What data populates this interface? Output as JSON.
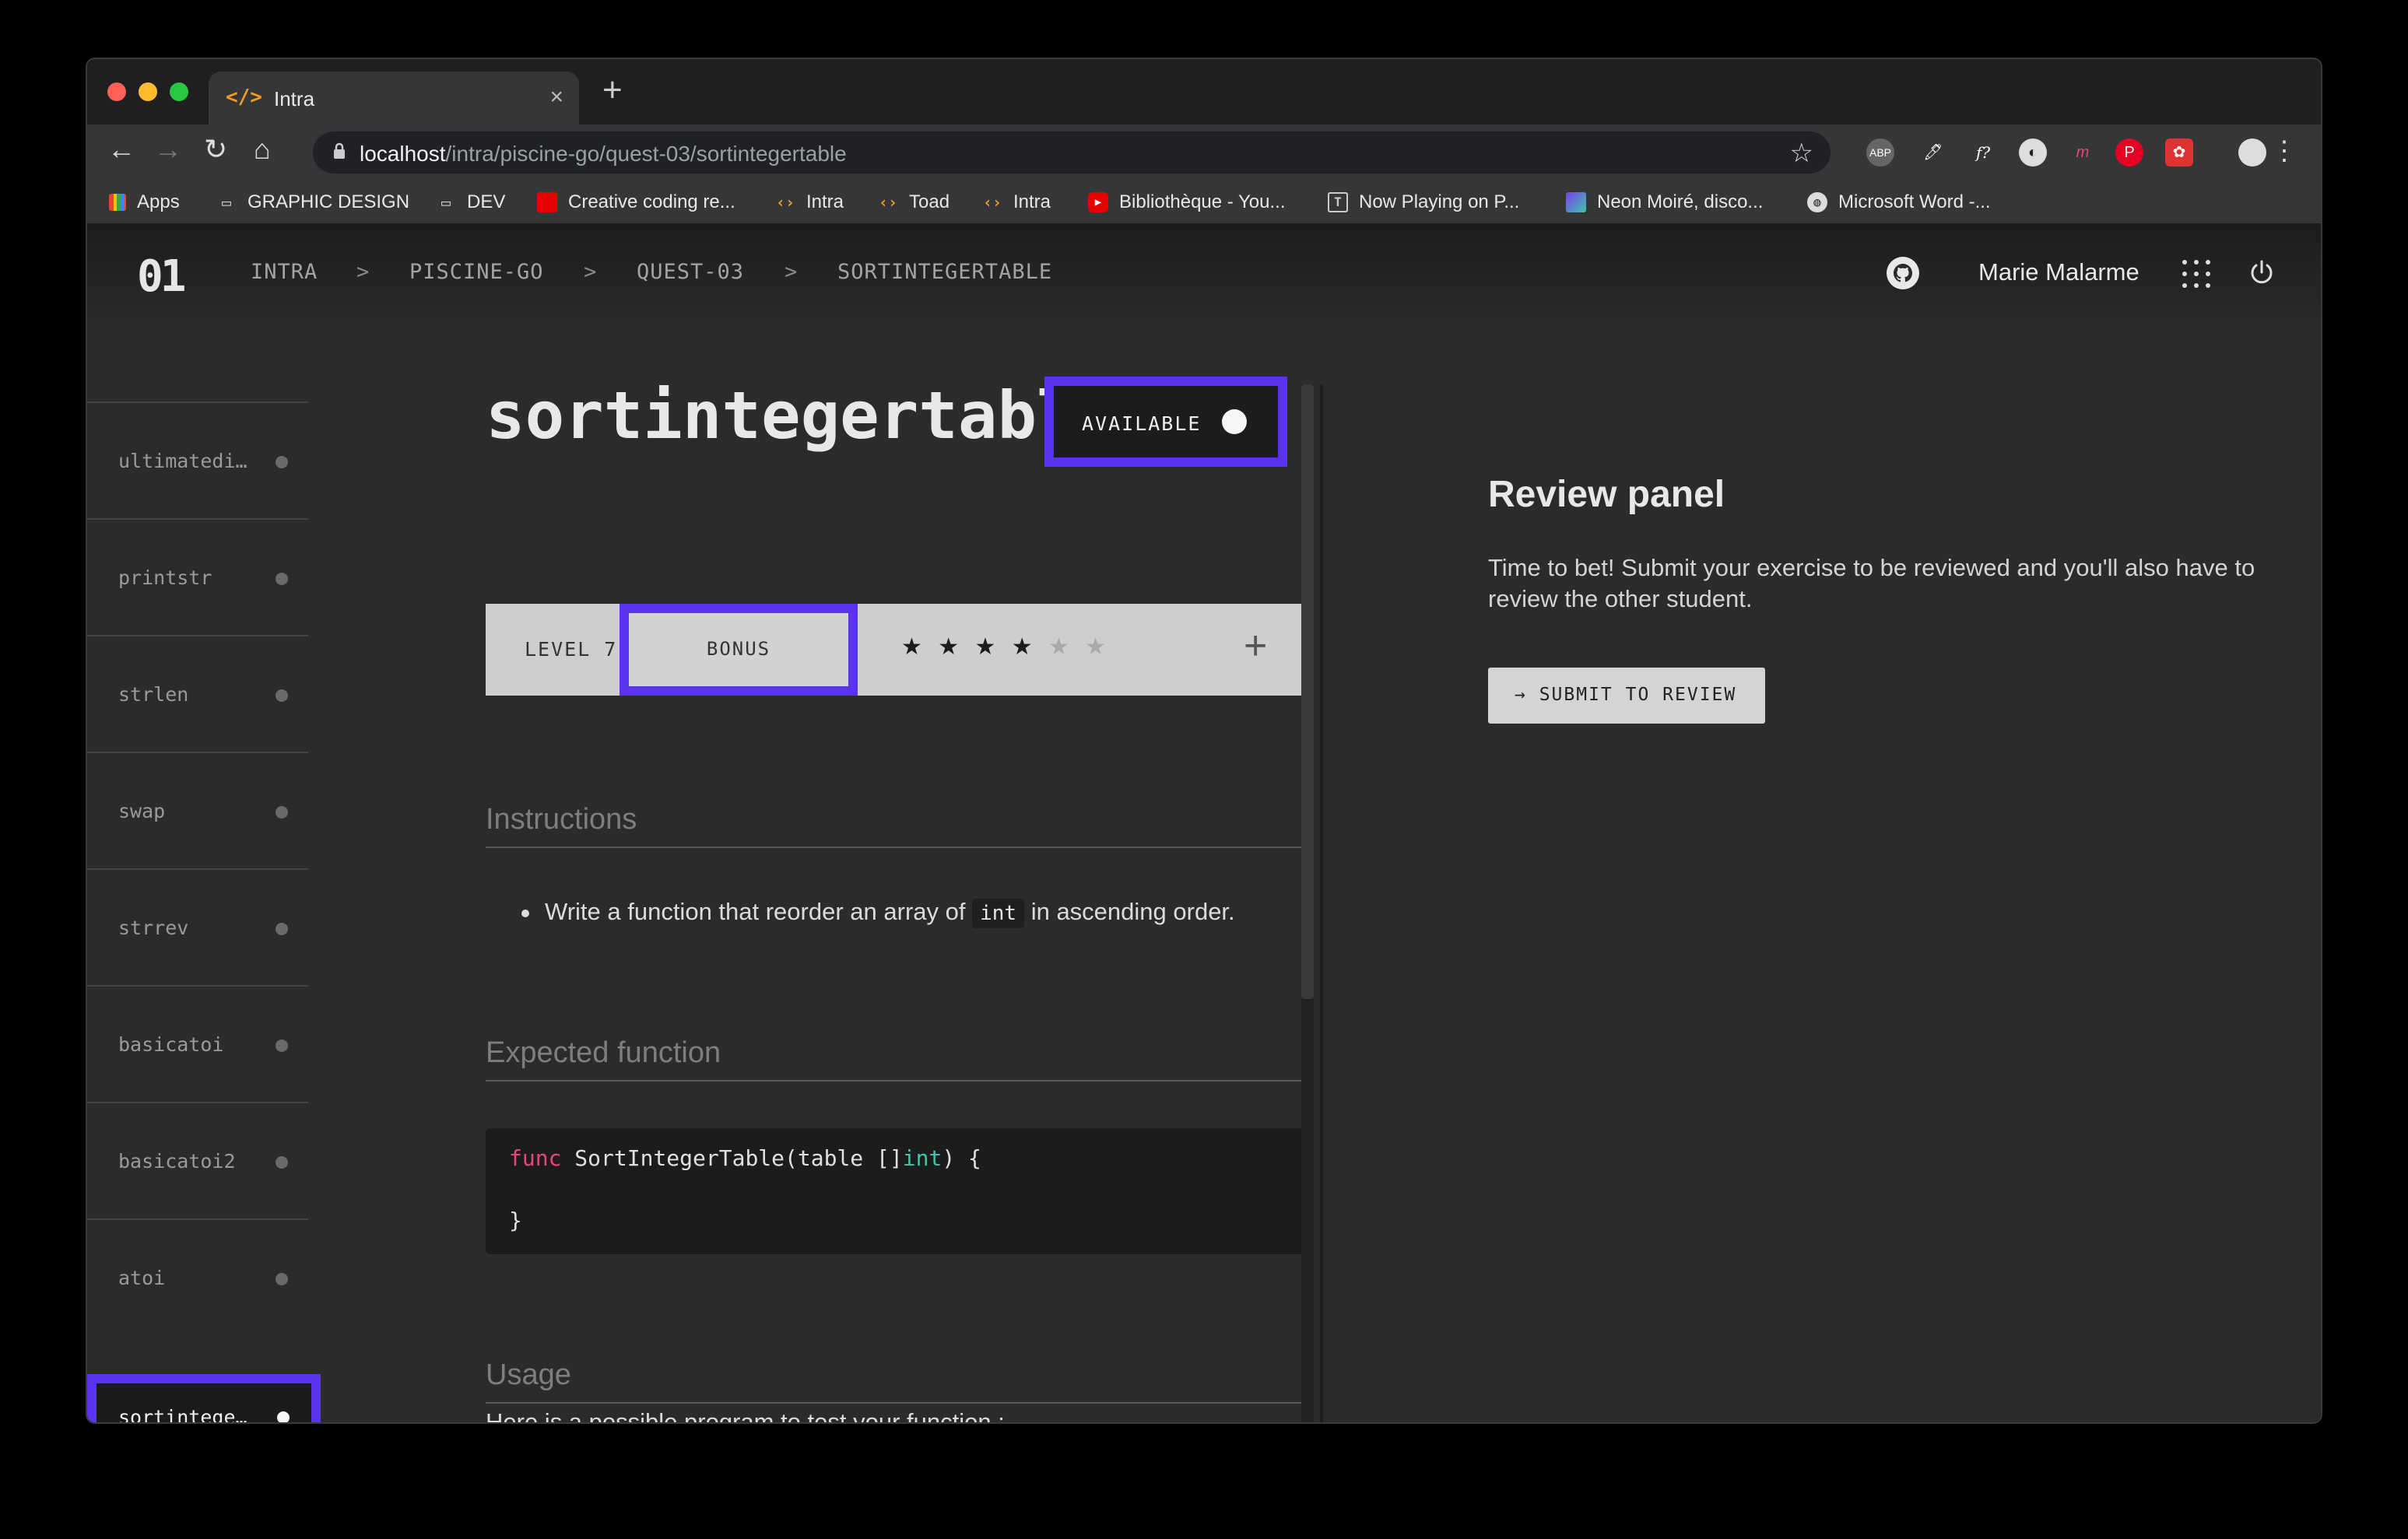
{
  "browser": {
    "tab_title": "Intra",
    "tab_icon": "</>",
    "new_tab": "+",
    "url_host": "localhost",
    "url_path": "/intra/piscine-go/quest-03/sortintegertable",
    "bookmarks": [
      {
        "label": "Apps",
        "icon": "apps-grid-icon"
      },
      {
        "label": "GRAPHIC DESIGN",
        "icon": "folder-icon"
      },
      {
        "label": "DEV",
        "icon": "folder-icon"
      },
      {
        "label": "Creative coding re...",
        "icon": "red-square-icon"
      },
      {
        "label": "Intra",
        "icon": "code-icon"
      },
      {
        "label": "Toad",
        "icon": "code-icon"
      },
      {
        "label": "Intra",
        "icon": "code-icon"
      },
      {
        "label": "Bibliothèque - You...",
        "icon": "youtube-icon"
      },
      {
        "label": "Now Playing on P...",
        "icon": "t-icon"
      },
      {
        "label": "Neon Moiré, disco...",
        "icon": "neon-icon"
      },
      {
        "label": "Microsoft Word -...",
        "icon": "globe-icon"
      }
    ]
  },
  "app": {
    "logo": "01",
    "breadcrumb": [
      "INTRA",
      ">",
      "PISCINE-GO",
      ">",
      "QUEST-03",
      ">",
      "SORTINTEGERTABLE"
    ],
    "user_name": "Marie Malarme"
  },
  "sidebar": {
    "items": [
      {
        "label": "ultimatediv…"
      },
      {
        "label": "printstr"
      },
      {
        "label": "strlen"
      },
      {
        "label": "swap"
      },
      {
        "label": "strrev"
      },
      {
        "label": "basicatoi"
      },
      {
        "label": "basicatoi2"
      },
      {
        "label": "atoi"
      }
    ],
    "active": {
      "label": "sortinteger…"
    }
  },
  "exercise": {
    "title": "sortintegertable",
    "status": "AVAILABLE",
    "level": "LEVEL 7",
    "bonus": "BONUS",
    "stars_filled": 4,
    "stars_total": 6,
    "stars_on": "★ ★ ★ ★",
    "stars_off": "★ ★",
    "plus": "+",
    "instructions_heading": "Instructions",
    "instruction_pre": "Write a function that reorder an array of",
    "instruction_code": "int",
    "instruction_post": "in ascending order.",
    "expected_heading": "Expected function",
    "code_kw": "func",
    "code_sig": " SortIntegerTable(table []",
    "code_type": "int",
    "code_end": ") {",
    "code_close": "}",
    "usage_heading": "Usage",
    "usage_text": "Here is a possible program to test your function :"
  },
  "review": {
    "heading": "Review panel",
    "text": "Time to bet! Submit your exercise to be reviewed and you'll also have to review the other student.",
    "button": "→  SUBMIT TO REVIEW"
  },
  "colors": {
    "highlight": "#5a33f0",
    "keyword": "#e8467a",
    "type": "#3ec6a9"
  }
}
